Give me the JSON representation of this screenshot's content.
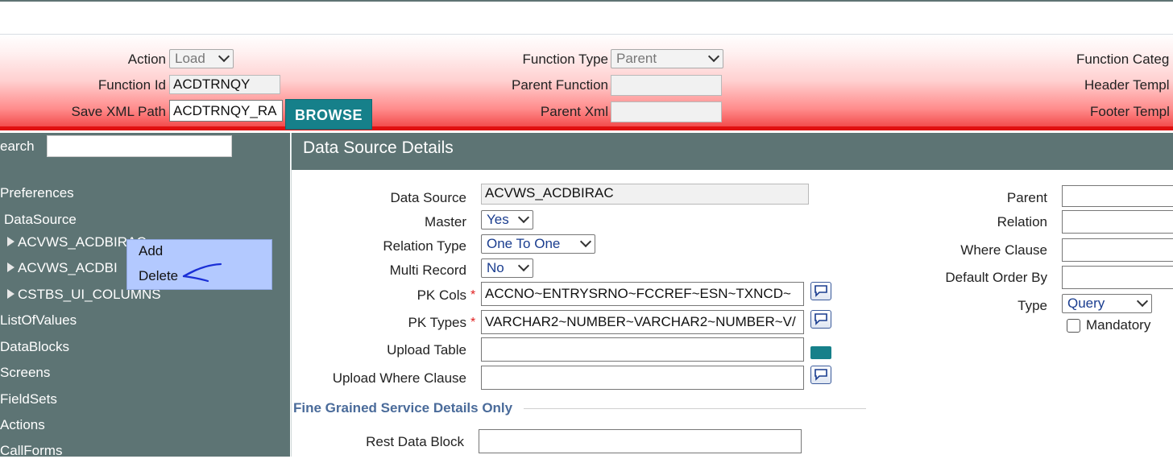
{
  "header": {
    "action_label": "Action",
    "action_value": "Load",
    "function_id_label": "Function Id",
    "function_id_value": "ACDTRNQY",
    "save_xml_label": "Save XML Path",
    "save_xml_value": "ACDTRNQY_RA",
    "browse_label": "BROWSE",
    "function_type_label": "Function Type",
    "function_type_value": "Parent",
    "parent_function_label": "Parent Function",
    "parent_function_value": "",
    "parent_xml_label": "Parent Xml",
    "parent_xml_value": "",
    "function_category_label": "Function Categ",
    "header_template_label": "Header Templ",
    "footer_template_label": "Footer Templ"
  },
  "sidebar": {
    "search_label": "earch",
    "search_value": "",
    "items": [
      {
        "label": "Preferences"
      },
      {
        "label": "DataSource"
      },
      {
        "label": "ACVWS_ACDBIRAC"
      },
      {
        "label": "ACVWS_ACDBI"
      },
      {
        "label": "CSTBS_UI_COLUMNS"
      },
      {
        "label": "ListOfValues"
      },
      {
        "label": "DataBlocks"
      },
      {
        "label": "Screens"
      },
      {
        "label": "FieldSets"
      },
      {
        "label": "Actions"
      },
      {
        "label": "CallForms"
      }
    ],
    "context_menu": {
      "items": [
        {
          "label": "Add"
        },
        {
          "label": "Delete"
        }
      ]
    }
  },
  "main": {
    "title": "Data Source Details",
    "form": {
      "data_source_label": "Data Source",
      "data_source_value": "ACVWS_ACDBIRAC",
      "master_label": "Master",
      "master_value": "Yes",
      "relation_type_label": "Relation Type",
      "relation_type_value": "One To One",
      "multi_record_label": "Multi Record",
      "multi_record_value": "No",
      "pk_cols_label": "PK Cols",
      "pk_cols_value": "ACCNO~ENTRYSRNO~FCCREF~ESN~TXNCD~",
      "pk_types_label": "PK Types",
      "pk_types_value": "VARCHAR2~NUMBER~VARCHAR2~NUMBER~V/",
      "upload_table_label": "Upload Table",
      "upload_table_value": "",
      "upload_where_label": "Upload Where Clause",
      "upload_where_value": "",
      "required_marker": "*"
    },
    "right_form": {
      "parent_label": "Parent",
      "relation_label": "Relation",
      "where_clause_label": "Where Clause",
      "default_order_label": "Default Order By",
      "type_label": "Type",
      "type_value": "Query",
      "mandatory_label": "Mandatory"
    },
    "fine_grained": {
      "title": "Fine Grained Service Details Only",
      "rest_data_block_label": "Rest Data Block",
      "rest_data_block_value": ""
    }
  },
  "colors": {
    "sidebar_bg": "#5d7474",
    "accent_teal": "#16808a",
    "header_red": "#e01010",
    "context_menu_bg": "#b3c9ff"
  }
}
